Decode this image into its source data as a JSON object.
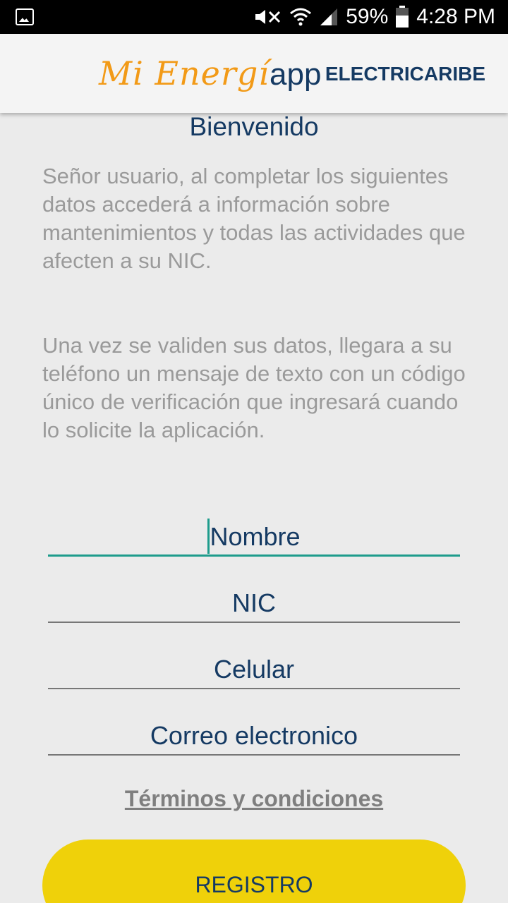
{
  "status_bar": {
    "battery": "59%",
    "time": "4:28 PM",
    "icons": [
      "gallery-notification-icon",
      "mute-icon",
      "wifi-icon",
      "signal-icon",
      "battery-icon"
    ]
  },
  "header": {
    "logo_mi": "Mi Energí",
    "logo_app": "app",
    "brand": "ELECTRICARIBE"
  },
  "main": {
    "title": "Bienvenido",
    "paragraph1": "Señor usuario, al completar los siguientes datos accederá a información sobre mantenimientos y todas las actividades que afecten a su NIC.",
    "paragraph2": "Una vez se validen sus datos, llegara a su teléfono un mensaje de texto con un código único de verificación que ingresará cuando lo solicite la aplicación."
  },
  "form": {
    "name_placeholder": "Nombre",
    "nic_placeholder": "NIC",
    "phone_placeholder": "Celular",
    "email_placeholder": "Correo electronico",
    "terms_link": "Términos y condiciones",
    "register_button": "REGISTRO"
  },
  "colors": {
    "accent_teal": "#1e9c8c",
    "brand_navy": "#153a63",
    "logo_orange": "#f29a17",
    "button_yellow": "#efd10a"
  }
}
